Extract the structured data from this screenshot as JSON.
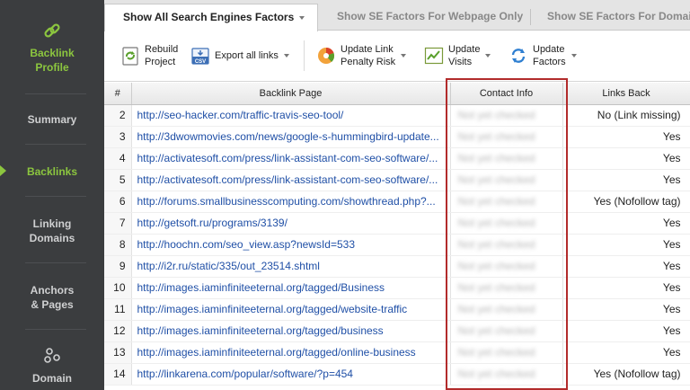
{
  "sidebar": {
    "items": [
      {
        "label": "Backlink Profile",
        "active": true
      },
      {
        "label": "Summary",
        "active": false
      },
      {
        "label": "Backlinks",
        "active": true
      },
      {
        "label": "Linking Domains",
        "active": false
      },
      {
        "label": "Anchors & Pages",
        "active": false
      },
      {
        "label": "Domain",
        "active": false
      }
    ],
    "accent_color": "#8cc63f"
  },
  "tabs": [
    {
      "label": "Show All Search Engines Factors",
      "active": true
    },
    {
      "label": "Show SE Factors For Webpage Only",
      "active": false
    },
    {
      "label": "Show SE Factors For Domain",
      "active": false
    }
  ],
  "toolbar": {
    "rebuild_line1": "Rebuild",
    "rebuild_line2": "Project",
    "export_label": "Export all links",
    "penalty_line1": "Update Link",
    "penalty_line2": "Penalty Risk",
    "visits_line1": "Update",
    "visits_line2": "Visits",
    "factors_line1": "Update",
    "factors_line2": "Factors"
  },
  "table": {
    "headers": {
      "num": "#",
      "page": "Backlink Page",
      "contact": "Contact Info",
      "links": "Links Back"
    },
    "contact_placeholder": "Not yet checked",
    "rows": [
      {
        "num": "2",
        "page": "http://seo-hacker.com/traffic-travis-seo-tool/",
        "links": "No (Link missing)"
      },
      {
        "num": "3",
        "page": "http://3dwowmovies.com/news/google-s-hummingbird-update...",
        "links": "Yes"
      },
      {
        "num": "4",
        "page": "http://activatesoft.com/press/link-assistant-com-seo-software/...",
        "links": "Yes"
      },
      {
        "num": "5",
        "page": "http://activatesoft.com/press/link-assistant-com-seo-software/...",
        "links": "Yes"
      },
      {
        "num": "6",
        "page": "http://forums.smallbusinesscomputing.com/showthread.php?...",
        "links": "Yes (Nofollow tag)"
      },
      {
        "num": "7",
        "page": "http://getsoft.ru/programs/3139/",
        "links": "Yes"
      },
      {
        "num": "8",
        "page": "http://hoochn.com/seo_view.asp?newsId=533",
        "links": "Yes"
      },
      {
        "num": "9",
        "page": "http://i2r.ru/static/335/out_23514.shtml",
        "links": "Yes"
      },
      {
        "num": "10",
        "page": "http://images.iaminfiniteeternal.org/tagged/Business",
        "links": "Yes"
      },
      {
        "num": "11",
        "page": "http://images.iaminfiniteeternal.org/tagged/website-traffic",
        "links": "Yes"
      },
      {
        "num": "12",
        "page": "http://images.iaminfiniteeternal.org/tagged/business",
        "links": "Yes"
      },
      {
        "num": "13",
        "page": "http://images.iaminfiniteeternal.org/tagged/online-business",
        "links": "Yes"
      },
      {
        "num": "14",
        "page": "http://linkarena.com/popular/software/?p=454",
        "links": "Yes (Nofollow tag)"
      }
    ]
  },
  "highlight_color": "#b22b2b"
}
